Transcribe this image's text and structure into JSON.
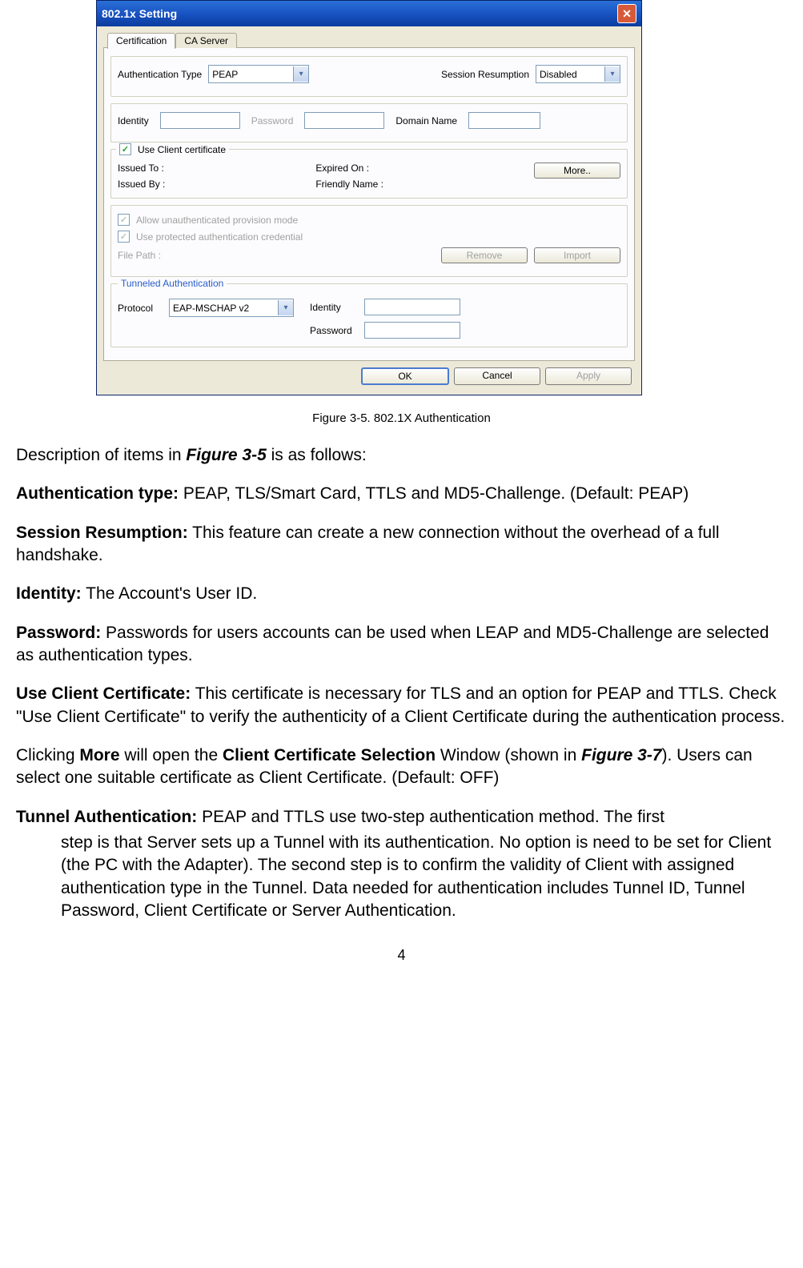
{
  "window": {
    "title": "802.1x Setting",
    "tabs": {
      "cert": "Certification",
      "ca": "CA Server"
    },
    "auth_type_label": "Authentication Type",
    "auth_type_value": "PEAP",
    "session_label": "Session Resumption",
    "session_value": "Disabled",
    "identity_label": "Identity",
    "password_label": "Password",
    "domain_label": "Domain Name",
    "use_client_cert": "Use Client certificate",
    "issued_to": "Issued To :",
    "issued_by": "Issued By :",
    "expired_on": "Expired On :",
    "friendly_name": "Friendly Name :",
    "more_btn": "More..",
    "allow_unauth": "Allow unauthenticated provision mode",
    "use_protected": "Use protected authentication credential",
    "file_path_label": "File Path :",
    "remove_btn": "Remove",
    "import_btn": "Import",
    "tunnel_title": "Tunneled Authentication",
    "protocol_label": "Protocol",
    "protocol_value": "EAP-MSCHAP v2",
    "tunnel_identity_label": "Identity",
    "tunnel_password_label": "Password",
    "ok_btn": "OK",
    "cancel_btn": "Cancel",
    "apply_btn": "Apply"
  },
  "caption": "Figure 3-5.    802.1X Authentication",
  "doc": {
    "intro_pre": "Description of items in ",
    "intro_fig": "Figure 3-5",
    "intro_post": " is as follows:",
    "auth_head": "Authentication type:",
    "auth_body": " PEAP, TLS/Smart Card, TTLS and MD5-Challenge. (Default: PEAP)",
    "sess_head": "Session Resumption:",
    "sess_body": " This feature can create a new connection without the overhead of a full handshake.",
    "id_head": "Identity:",
    "id_body": " The Account's User ID.",
    "pw_head": "Password:",
    "pw_body": " Passwords for users accounts can be used when LEAP and MD5-Challenge are selected as authentication types.",
    "ucc_head": "Use Client Certificate:",
    "ucc_body": " This certificate is necessary for TLS and an option for PEAP and TTLS. Check \"Use Client Certificate\" to verify the authenticity of a Client Certificate during the authentication process.",
    "more_pre": "Clicking ",
    "more_bold1": "More",
    "more_mid1": " will open the ",
    "more_bold2": "Client Certificate Selection",
    "more_mid2": " Window (shown in ",
    "more_fig": "Figure 3-7",
    "more_post": "). Users can select one suitable certificate as Client Certificate. (Default: OFF)",
    "tun_head": "Tunnel Authentication:",
    "tun_body_first": " PEAP and TTLS use two-step authentication method. The first",
    "tun_body_rest": "step is that Server sets up a Tunnel with its authentication. No option is need to be set for Client (the PC with the Adapter). The second step is to confirm the validity of Client with assigned authentication type in the Tunnel. Data needed for authentication includes Tunnel ID, Tunnel Password, Client Certificate or Server Authentication."
  },
  "page_number": "4"
}
